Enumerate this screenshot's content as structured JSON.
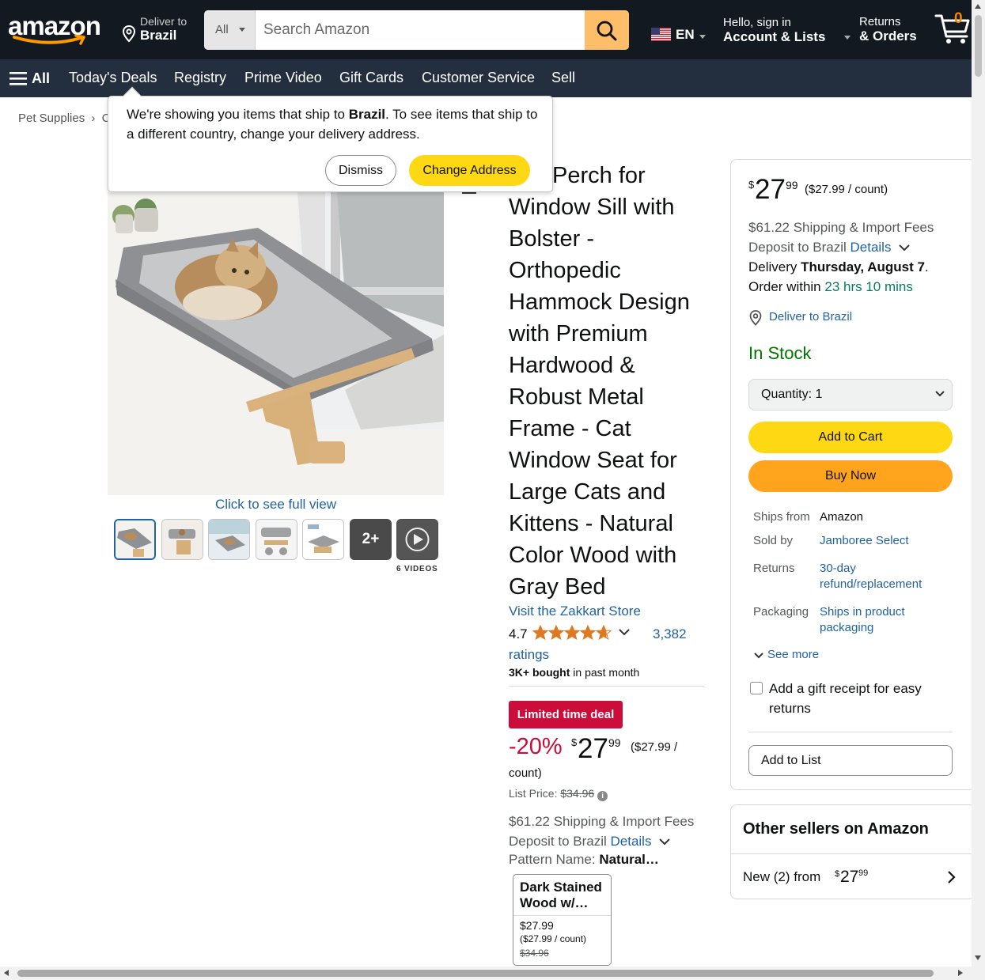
{
  "header": {
    "logo_text": "amazon",
    "deliver": {
      "line1": "Deliver to",
      "line2": "Brazil"
    },
    "search": {
      "category": "All",
      "placeholder": "Search Amazon",
      "value": ""
    },
    "language": "EN",
    "account": {
      "line1": "Hello, sign in",
      "line2": "Account & Lists"
    },
    "returns": {
      "line1": "Returns",
      "line2": "& Orders"
    },
    "cart_count": "0"
  },
  "subnav": {
    "all_label": "All",
    "items": [
      "Today's Deals",
      "Registry",
      "Prime Video",
      "Gift Cards",
      "Customer Service",
      "Sell"
    ]
  },
  "breadcrumb": {
    "first": "Pet Supplies",
    "sep": "›",
    "next": "C"
  },
  "popover": {
    "text_before": "We're showing you items that ship to ",
    "country": "Brazil",
    "text_after": ". To see items that ship to a different country, change your delivery address.",
    "dismiss": "Dismiss",
    "change": "Change Address"
  },
  "gallery": {
    "full_view": "Click to see full view",
    "more_count": "2+",
    "videos_label": "6 VIDEOS"
  },
  "product": {
    "title": "Perch for Window Sill with Bolster - Orthopedic Hammock Design with Premium Hardwood & Robust Metal Frame - Cat Window Seat for Large Cats and Kittens - Natural Color Wood with Gray Bed",
    "store": "Visit the Zakkart Store",
    "rating": "4.7",
    "rating_value": 4.7,
    "rating_count": "3,382",
    "ratings_word": "ratings",
    "bought_bold": "3K+ bought",
    "bought_rest": " in past month",
    "deal_badge": "Limited time deal",
    "discount": "-20%",
    "price_symbol": "$",
    "price_whole": "27",
    "price_fraction": "99",
    "unit_price_a": "($27.99 /",
    "unit_price_b": "count)",
    "list_price_label": "List Price: ",
    "list_price": "$34.96",
    "shipping_line1": "$61.22 Shipping & Import Fees",
    "shipping_line2": "Deposit to Brazil ",
    "details": "Details",
    "pattern_label": "Pattern Name: ",
    "pattern_value": "Natural…",
    "swatch": {
      "name": "Dark Stained Wood w/…",
      "price": "$27.99",
      "unit": "($27.99 / count)",
      "list": "$34.96"
    }
  },
  "buybox": {
    "price_symbol": "$",
    "price_whole": "27",
    "price_fraction": "99",
    "unit_price": "($27.99 / count)",
    "shipping_line1": "$61.22 Shipping & Import Fees",
    "shipping_line2": "Deposit to Brazil ",
    "details": "Details",
    "delivery_prefix": "Delivery ",
    "delivery_date": "Thursday, August 7",
    "delivery_suffix": ".",
    "order_within": "Order within ",
    "countdown": "23 hrs 10 mins",
    "deliver_to": "Deliver to Brazil",
    "stock": "In Stock",
    "quantity": "Quantity:  1",
    "add_to_cart": "Add to Cart",
    "buy_now": "Buy Now",
    "info": [
      {
        "key": "Ships from",
        "value": "Amazon"
      },
      {
        "key": "Sold by",
        "value": "Jamboree Select"
      },
      {
        "key": "Returns",
        "value": "30-day refund/replacement"
      },
      {
        "key": "Packaging",
        "value": "Ships in product packaging"
      }
    ],
    "see_more": "See more",
    "gift_receipt": "Add a gift receipt for easy returns",
    "add_to_list": "Add to List"
  },
  "other_sellers": {
    "heading": "Other sellers on Amazon",
    "new_from": "New (2) from",
    "price_symbol": "$",
    "price_whole": "27",
    "price_fraction": "99"
  },
  "colors": {
    "nav_dark": "#131921",
    "nav_sub": "#232f3e",
    "search_button": "#febd69",
    "add_to_cart": "#ffd814",
    "buy_now": "#ffa41c",
    "deal_red": "#cc0c39",
    "in_stock_green": "#007600",
    "link_blue": "#2162a1",
    "star_orange": "#de7921"
  }
}
